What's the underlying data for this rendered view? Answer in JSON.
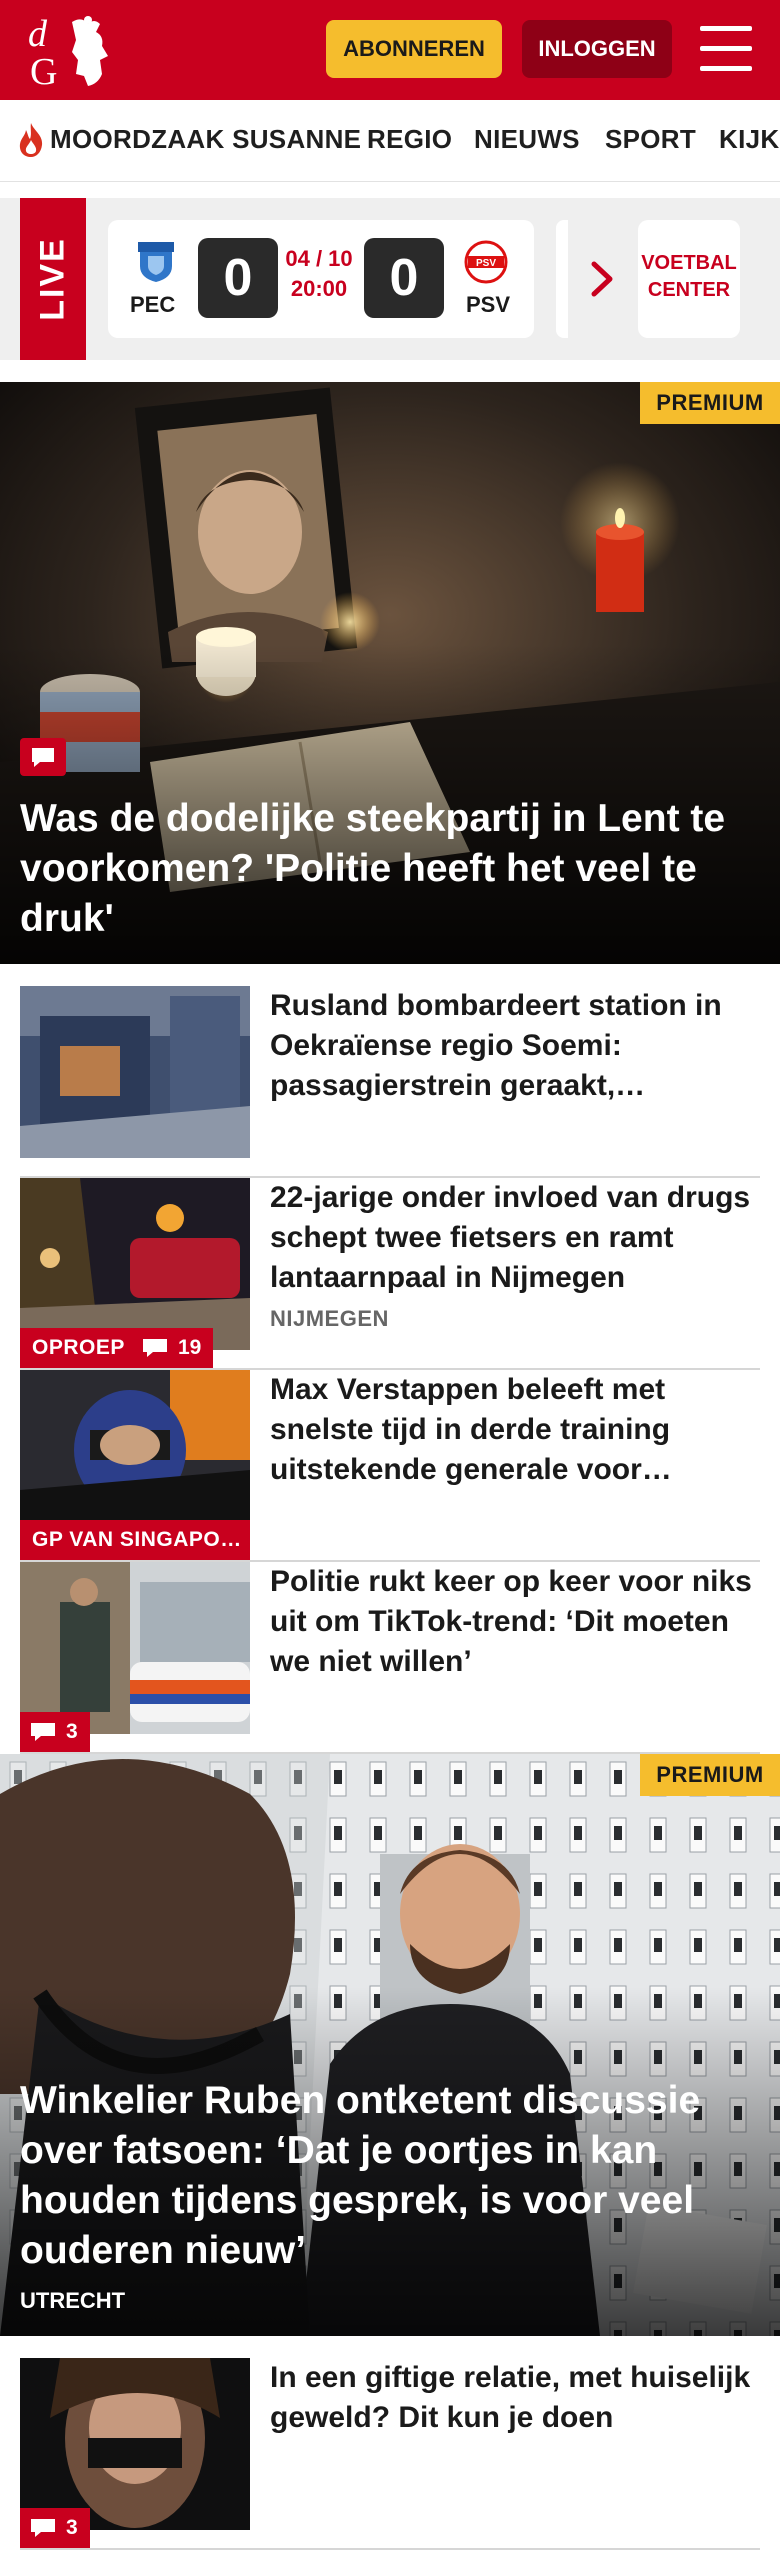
{
  "header": {
    "subscribe_label": "ABONNEREN",
    "login_label": "INLOGGEN",
    "brand_color": "#c8001e",
    "accent_color": "#f5bd2d"
  },
  "nav": {
    "items": [
      "MOORDZAAK SUSANNE",
      "REGIO",
      "NIEUWS",
      "SPORT",
      "KIJK"
    ]
  },
  "live": {
    "label": "LIVE",
    "match": {
      "home": "PEC",
      "away": "PSV",
      "home_score": "0",
      "away_score": "0",
      "date": "04 / 10",
      "time": "20:00"
    },
    "center_label": "VOETBAL CENTER"
  },
  "hero1": {
    "badge": "PREMIUM",
    "title": "Was de dodelijke steekpartij in Lent te voorkomen? 'Politie heeft het veel te druk'"
  },
  "articles": [
    {
      "title": "Rusland bombardeert station in Oekraïense regio Soemi: passagierstrein geraakt,…"
    },
    {
      "title": "22-jarige onder invloed van drugs schept twee fietsers en ramt lantaarnpaal in Nijmegen",
      "meta": "NIJMEGEN",
      "tag": "OPROEP",
      "comments": "19"
    },
    {
      "title": "Max Verstappen beleeft met snelste tijd in derde training uitstekende generale voor…",
      "tag": "GP VAN SINGAPO…"
    },
    {
      "title": "Politie rukt keer op keer voor niks uit om TikTok-trend: ‘Dit moeten we niet willen’",
      "comments": "3"
    }
  ],
  "hero2": {
    "badge": "PREMIUM",
    "title": "Winkelier Ruben ontketent discussie over fatsoen: ‘Dat je oortjes in kan houden tijdens gesprek, is voor veel ouderen nieuw’",
    "location": "UTRECHT"
  },
  "articles2": [
    {
      "title": "In een giftige relatie, met huiselijk geweld? Dit kun je doen",
      "comments": "3"
    }
  ]
}
